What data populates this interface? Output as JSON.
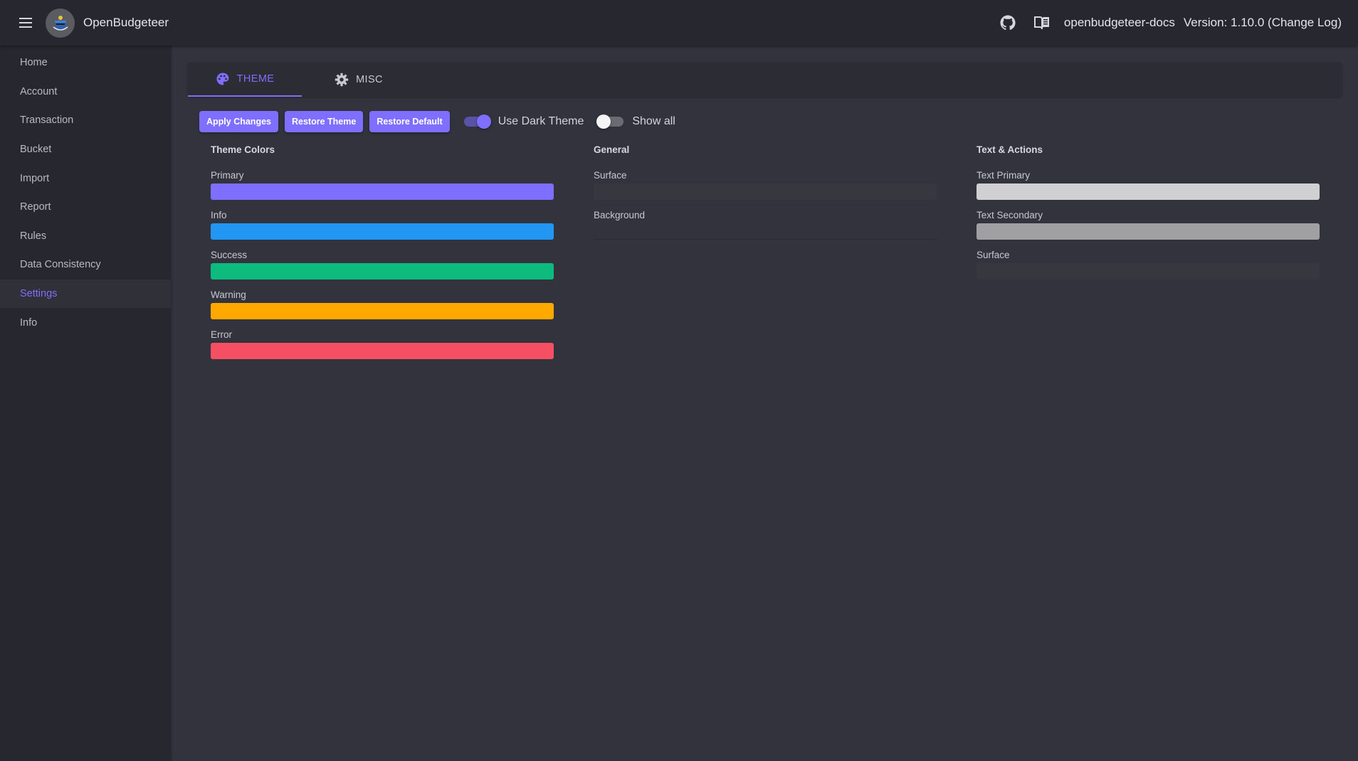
{
  "appbar": {
    "title": "OpenBudgeteer",
    "docs_link": "openbudgeteer-docs",
    "version_prefix": "Version: 1.10.0",
    "changelog_link": "(Change Log)",
    "icons": {
      "menu": "hamburger-menu-icon",
      "github": "github-icon",
      "docs": "book-icon"
    }
  },
  "sidebar": {
    "items": [
      {
        "label": "Home",
        "active": false
      },
      {
        "label": "Account",
        "active": false
      },
      {
        "label": "Transaction",
        "active": false
      },
      {
        "label": "Bucket",
        "active": false
      },
      {
        "label": "Import",
        "active": false
      },
      {
        "label": "Report",
        "active": false
      },
      {
        "label": "Rules",
        "active": false
      },
      {
        "label": "Data Consistency",
        "active": false
      },
      {
        "label": "Settings",
        "active": true
      },
      {
        "label": "Info",
        "active": false
      }
    ]
  },
  "tabs": [
    {
      "label": "THEME",
      "icon": "palette-icon",
      "active": true
    },
    {
      "label": "MISC",
      "icon": "gear-icon",
      "active": false
    }
  ],
  "toolbar": {
    "apply_label": "Apply Changes",
    "restore_theme_label": "Restore Theme",
    "restore_default_label": "Restore Default",
    "dark_theme_label": "Use Dark Theme",
    "dark_theme_on": true,
    "show_all_label": "Show all",
    "show_all_on": false
  },
  "groups": {
    "theme_colors": {
      "heading": "Theme Colors",
      "fields": [
        {
          "label": "Primary",
          "color": "#7e6fff"
        },
        {
          "label": "Info",
          "color": "#2196f3"
        },
        {
          "label": "Success",
          "color": "#0cbb7d"
        },
        {
          "label": "Warning",
          "color": "#ffa800"
        },
        {
          "label": "Error",
          "color": "#f64e62"
        }
      ]
    },
    "general": {
      "heading": "General",
      "fields": [
        {
          "label": "Surface",
          "color": "#373740"
        },
        {
          "label": "Background",
          "color": "#32333d"
        }
      ]
    },
    "text_actions": {
      "heading": "Text & Actions",
      "fields": [
        {
          "label": "Text Primary",
          "color": "#d0d0d2"
        },
        {
          "label": "Text Secondary",
          "color": "#a0a0a3"
        },
        {
          "label": "Surface",
          "color": "#373740"
        }
      ]
    }
  },
  "colors": {
    "accent": "#7e6fff",
    "appbar_bg": "#27272f",
    "page_bg": "#32333d"
  }
}
